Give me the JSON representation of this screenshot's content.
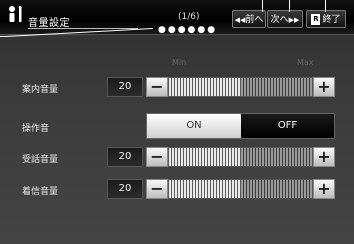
{
  "header": {
    "title": "音量設定",
    "page_indicator": "(1/6)",
    "page_dots": "●●●●●●",
    "prev_label": "前へ",
    "next_label": "次へ",
    "end_label": "終了",
    "prev_arrow": "◀◀",
    "next_arrow": "▶▶",
    "end_icon_text": "R"
  },
  "scale": {
    "min_label": "Min",
    "max_label": "Max"
  },
  "rows": [
    {
      "label": "案内音量",
      "value": "20",
      "level": 0.5
    },
    {
      "label": "操作音",
      "on_label": "ON",
      "off_label": "OFF",
      "selected": "ON"
    },
    {
      "label": "受話音量",
      "value": "20",
      "level": 0.5
    },
    {
      "label": "着信音量",
      "value": "20",
      "level": 0.5
    }
  ],
  "buttons": {
    "minus": "−",
    "plus": "+"
  },
  "colors": {
    "background": "#3a3a3a",
    "header": "#000000",
    "button_face": "#e8e8e8"
  }
}
